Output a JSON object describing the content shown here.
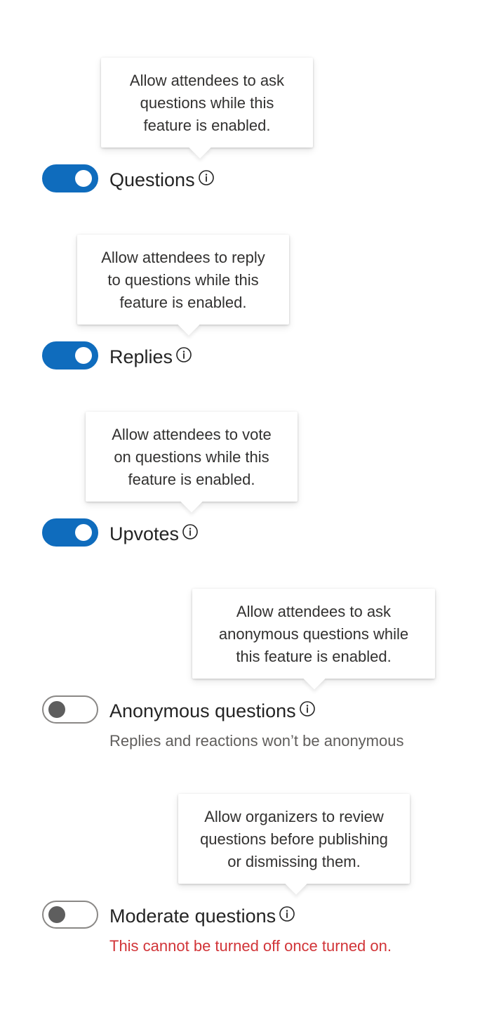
{
  "colors": {
    "accent": "#0f6cbd",
    "warning": "#d13438",
    "secondary_text": "#605e5c",
    "toggle_off_knob": "#5e5e5e"
  },
  "settings": [
    {
      "label": "Questions",
      "enabled": true,
      "tooltip": [
        "Allow attendees to ask",
        "questions while this",
        "feature is enabled."
      ],
      "icon": "info-icon"
    },
    {
      "label": "Replies",
      "enabled": true,
      "tooltip": [
        "Allow attendees to reply",
        "to questions while this",
        "feature is enabled."
      ],
      "icon": "info-icon"
    },
    {
      "label": "Upvotes",
      "enabled": true,
      "tooltip": [
        "Allow attendees to vote",
        "on questions while this",
        "feature is enabled."
      ],
      "icon": "info-icon"
    },
    {
      "label": "Anonymous questions",
      "enabled": false,
      "tooltip": [
        "Allow attendees to ask",
        "anonymous questions while",
        "this feature is enabled."
      ],
      "subtext": "Replies and reactions won’t be anonymous",
      "icon": "info-icon"
    },
    {
      "label": "Moderate questions",
      "enabled": false,
      "tooltip": [
        "Allow organizers to review",
        "questions before publishing",
        "or dismissing them."
      ],
      "warning": "This cannot be turned off once turned on.",
      "icon": "info-icon"
    }
  ]
}
